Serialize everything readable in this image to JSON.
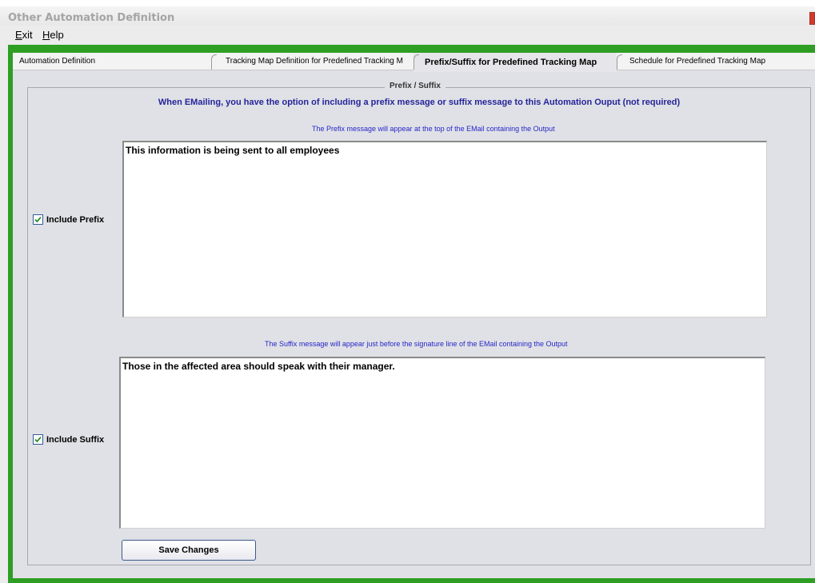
{
  "window": {
    "title": "Other Automation Definition"
  },
  "menu": {
    "exit": "Exit",
    "help": "Help"
  },
  "tabs": [
    {
      "label": "Automation Definition",
      "active": false
    },
    {
      "label": "Tracking Map Definition for Predefined Tracking M",
      "active": false
    },
    {
      "label": "Prefix/Suffix for Predefined Tracking Map",
      "active": true
    },
    {
      "label": "Schedule for Predefined Tracking Map",
      "active": false
    }
  ],
  "group": {
    "title": "Prefix / Suffix",
    "intro": "When EMailing, you have the option of including a prefix message or suffix message to this Automation Ouput (not required)"
  },
  "prefix": {
    "hint": "The Prefix message will appear at the top of the EMail containing the Output",
    "text": "This information is being sent to all employees",
    "checkbox_label": "Include Prefix",
    "checked": true
  },
  "suffix": {
    "hint": "The Suffix message will appear just before the signature line of the EMail containing the Output",
    "text": "Those in the affected area should speak with their manager.",
    "checkbox_label": "Include Suffix",
    "checked": true
  },
  "actions": {
    "save": "Save Changes"
  },
  "colors": {
    "frame": "#2e9e24",
    "hint_text": "#2626c8",
    "intro_text": "#24249a"
  }
}
